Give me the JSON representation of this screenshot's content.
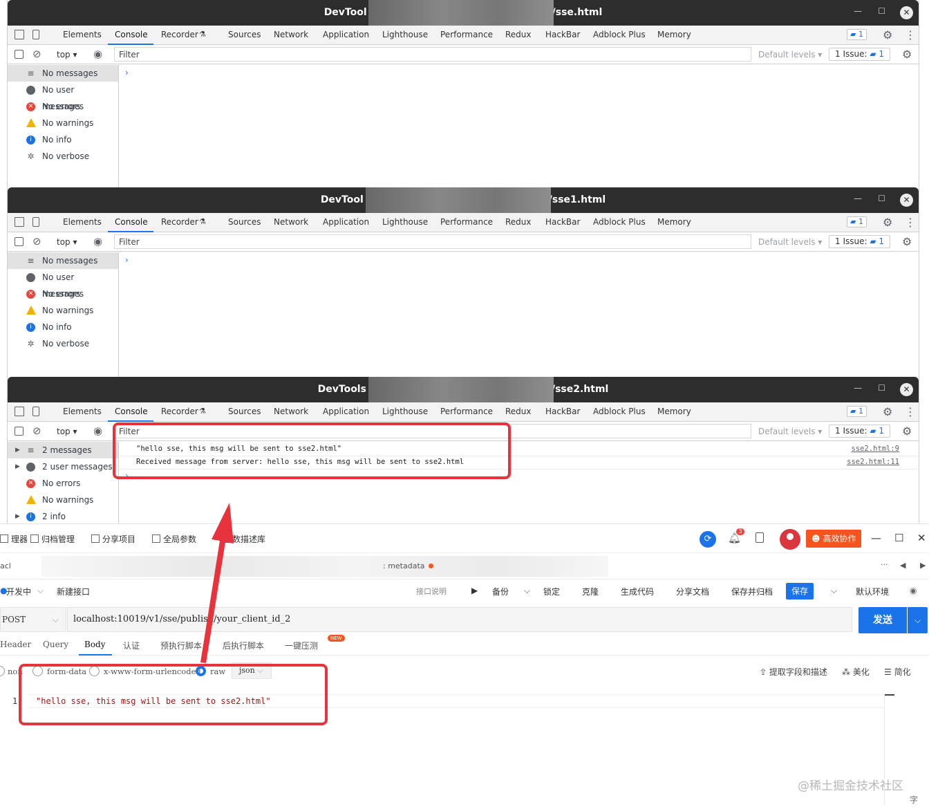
{
  "devtools": {
    "tabs": [
      "Elements",
      "Console",
      "Recorder",
      "Sources",
      "Network",
      "Application",
      "Lighthouse",
      "Performance",
      "Redux",
      "HackBar",
      "Adblock Plus",
      "Memory"
    ],
    "issues_count": "1",
    "context": "top",
    "filter_placeholder": "Filter",
    "default_levels": "Default levels",
    "issue_button": "1 Issue:",
    "windows": [
      {
        "title": "DevTool",
        "title_suffix": "/sse.html",
        "sidebar": [
          "No messages",
          "No user messages",
          "No errors",
          "No warnings",
          "No info",
          "No verbose"
        ],
        "logs": []
      },
      {
        "title": "DevTool",
        "title_suffix": "/sse1.html",
        "sidebar": [
          "No messages",
          "No user messages",
          "No errors",
          "No warnings",
          "No info",
          "No verbose"
        ],
        "logs": []
      },
      {
        "title": "DevTools",
        "title_suffix": "/sse2.html",
        "sidebar": [
          "2 messages",
          "2 user messages",
          "No errors",
          "No warnings",
          "2 info"
        ],
        "logs": [
          {
            "text": "\"hello sse, this msg will be sent to sse2.html\"",
            "source": "sse2.html:9"
          },
          {
            "text": "Received message from server: hello sse, this msg will be sent to sse2.html",
            "source": "sse2.html:11"
          }
        ]
      }
    ]
  },
  "api_client": {
    "nav": [
      "理器",
      "归档管理",
      "分享项目",
      "全局参数",
      "数描述库"
    ],
    "collab": "高效协作",
    "notif_count": "3",
    "tab_prefix": "acl",
    "tab_meta": ": metadata",
    "env_left": "开发中",
    "api_name": "新建接口",
    "api_desc": "接口说明",
    "toolbar": [
      "备份",
      "锁定",
      "克隆",
      "生成代码",
      "分享文档",
      "保存并归档"
    ],
    "save": "保存",
    "env_right": "默认环境",
    "method": "POST",
    "url": "localhost:10019/v1/sse/publish/your_client_id_2",
    "send": "发送",
    "req_tabs": [
      "Header",
      "Query",
      "Body",
      "认证",
      "预执行脚本",
      "后执行脚本",
      "一键压测"
    ],
    "new_badge": "NEW",
    "body_types": [
      "non",
      "form-data",
      "x-www-form-urlencoded",
      "raw"
    ],
    "raw_format": "json",
    "tools": [
      "提取字段和描述",
      "美化",
      "简化"
    ],
    "line_no": "1",
    "code": "\"hello sse, this msg will be sent to sse2.html\"",
    "watermark": "@稀土掘金技术社区",
    "corner": "字"
  },
  "colors": {
    "accent": "#1a73e8",
    "annotation": "#e8323c",
    "collab": "#f5541f"
  }
}
